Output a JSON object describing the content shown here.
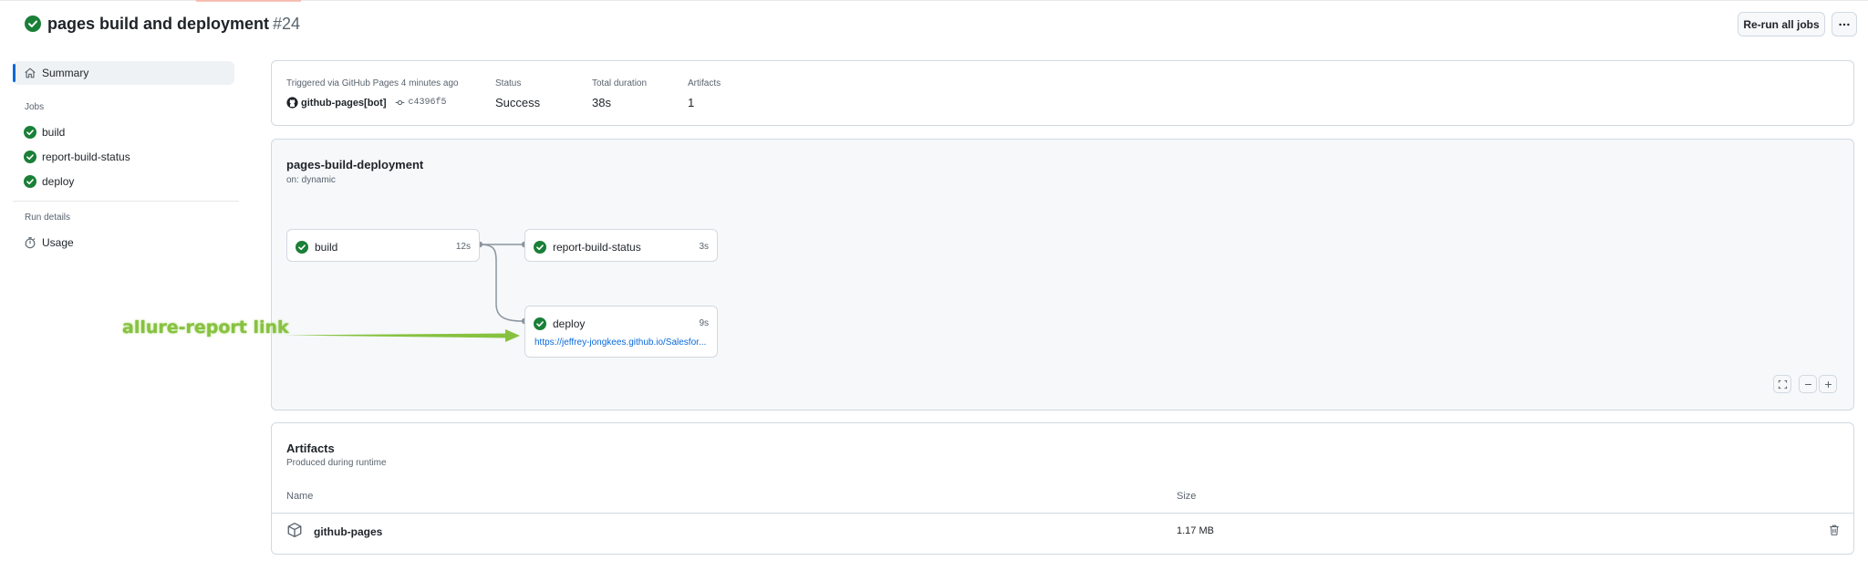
{
  "header": {
    "title": "pages build and deployment",
    "run_number": "#24",
    "rerun_label": "Re-run all jobs"
  },
  "sidebar": {
    "summary_label": "Summary",
    "jobs_heading": "Jobs",
    "jobs": [
      {
        "label": "build"
      },
      {
        "label": "report-build-status"
      },
      {
        "label": "deploy"
      }
    ],
    "run_details_heading": "Run details",
    "usage_label": "Usage"
  },
  "summary": {
    "trigger_text": "Triggered via GitHub Pages 4 minutes ago",
    "actor": "github-pages[bot]",
    "commit": "c4396f5",
    "status_label": "Status",
    "status_value": "Success",
    "duration_label": "Total duration",
    "duration_value": "38s",
    "artifacts_label": "Artifacts",
    "artifacts_value": "1"
  },
  "graph": {
    "workflow_name": "pages-build-deployment",
    "trigger": "on: dynamic",
    "jobs": [
      {
        "name": "build",
        "time": "12s"
      },
      {
        "name": "report-build-status",
        "time": "3s"
      },
      {
        "name": "deploy",
        "time": "9s",
        "link": "https://jeffrey-jongkees.github.io/Salesfor..."
      }
    ]
  },
  "annotation": {
    "text": "allure-report link"
  },
  "artifacts": {
    "title": "Artifacts",
    "subtitle": "Produced during runtime",
    "col_name": "Name",
    "col_size": "Size",
    "rows": [
      {
        "name": "github-pages",
        "size": "1.17 MB"
      }
    ]
  },
  "colors": {
    "success": "#1a7f37",
    "link": "#0969da",
    "accent": "#0969da",
    "annotation": "#86c240"
  }
}
